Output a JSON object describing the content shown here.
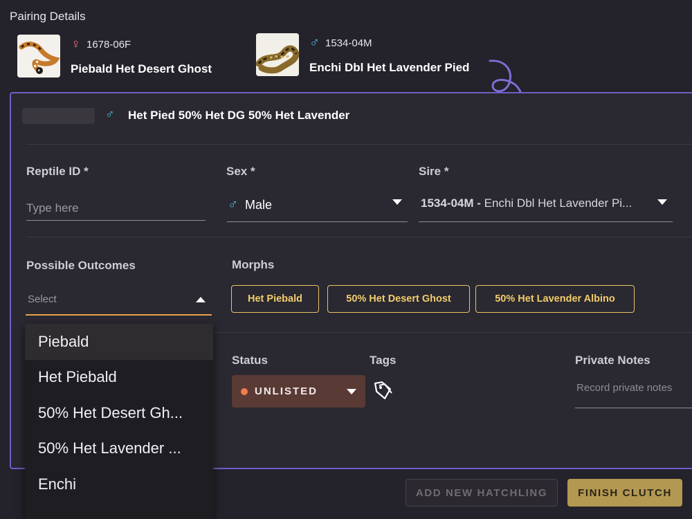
{
  "page_title": "Pairing Details",
  "dam": {
    "id": "1678-06F",
    "name": "Piebald Het Desert Ghost",
    "sex_symbol": "♀",
    "sex_icon": "female-icon"
  },
  "sire": {
    "id": "1534-04M",
    "name": "Enchi Dbl Het Lavender Pied",
    "sex_symbol": "♂",
    "sex_icon": "male-icon"
  },
  "hatchling": {
    "sex_symbol": "♂",
    "title": "Het Pied 50% Het DG 50% Het Lavender"
  },
  "form": {
    "reptile_id_label": "Reptile ID *",
    "reptile_id_placeholder": "Type here",
    "sex_label": "Sex *",
    "sex_symbol": "♂",
    "sex_value": "Male",
    "sire_label": "Sire *",
    "sire_value_id": "1534-04M",
    "sire_value_sep": " - ",
    "sire_value_name": "Enchi Dbl Het Lavender Pi...",
    "possible_outcomes_label": "Possible Outcomes",
    "possible_outcomes_placeholder": "Select",
    "morphs_label": "Morphs",
    "morphs": [
      "Het Piebald",
      "50% Het Desert Ghost",
      "50% Het Lavender Albino"
    ],
    "status_label": "Status",
    "status_value": "UNLISTED",
    "status_color": "#f47c4a",
    "tags_label": "Tags",
    "private_notes_label": "Private Notes",
    "private_notes_placeholder": "Record private notes"
  },
  "outcomes_menu": [
    "Piebald",
    "Het Piebald",
    "50% Het Desert Gh...",
    "50% Het Lavender ...",
    "Enchi"
  ],
  "buttons": {
    "add_new_hatchling": "ADD NEW HATCHLING",
    "finish_clutch": "FINISH CLUTCH"
  },
  "colors": {
    "accent_purple": "#6f5fc8",
    "gold": "#e8c66a",
    "finish_bg": "#b39852",
    "status_bg": "#5a3a35"
  }
}
